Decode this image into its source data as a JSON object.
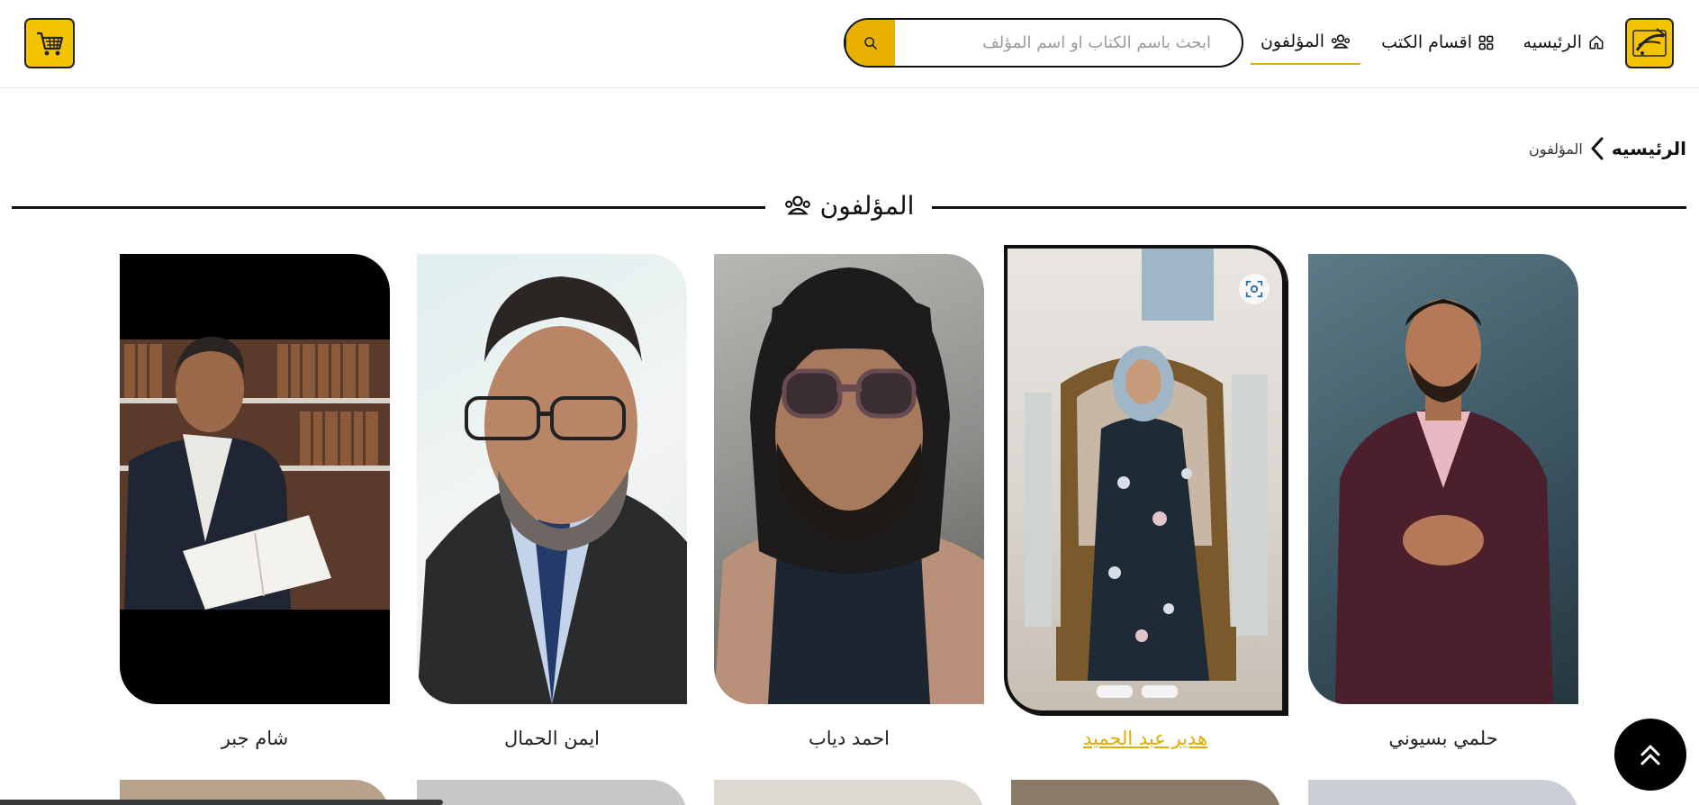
{
  "header": {
    "nav": {
      "home": "الرئيسيه",
      "categories": "اقسام الكتب",
      "authors": "المؤلفون"
    },
    "search": {
      "placeholder": "ابحث باسم الكتاب او اسم المؤلف",
      "value": ""
    },
    "icons": {
      "logo": "book-logo-icon",
      "home": "home-icon",
      "categories": "grid-icon",
      "authors": "users-icon",
      "search": "search-icon",
      "cart": "cart-icon"
    }
  },
  "breadcrumb": {
    "home": "الرئيسيه",
    "current": "المؤلفون"
  },
  "section": {
    "title": "المؤلفون"
  },
  "authors": [
    {
      "name": "حلمي بسيوني"
    },
    {
      "name": "هدير عبد الحميد",
      "active": true
    },
    {
      "name": "احمد دياب"
    },
    {
      "name": "ايمن الحمال"
    },
    {
      "name": "شام جبر"
    }
  ],
  "colors": {
    "accent": "#e2ad00",
    "logo_bg": "#f5c400",
    "text": "#111111"
  }
}
